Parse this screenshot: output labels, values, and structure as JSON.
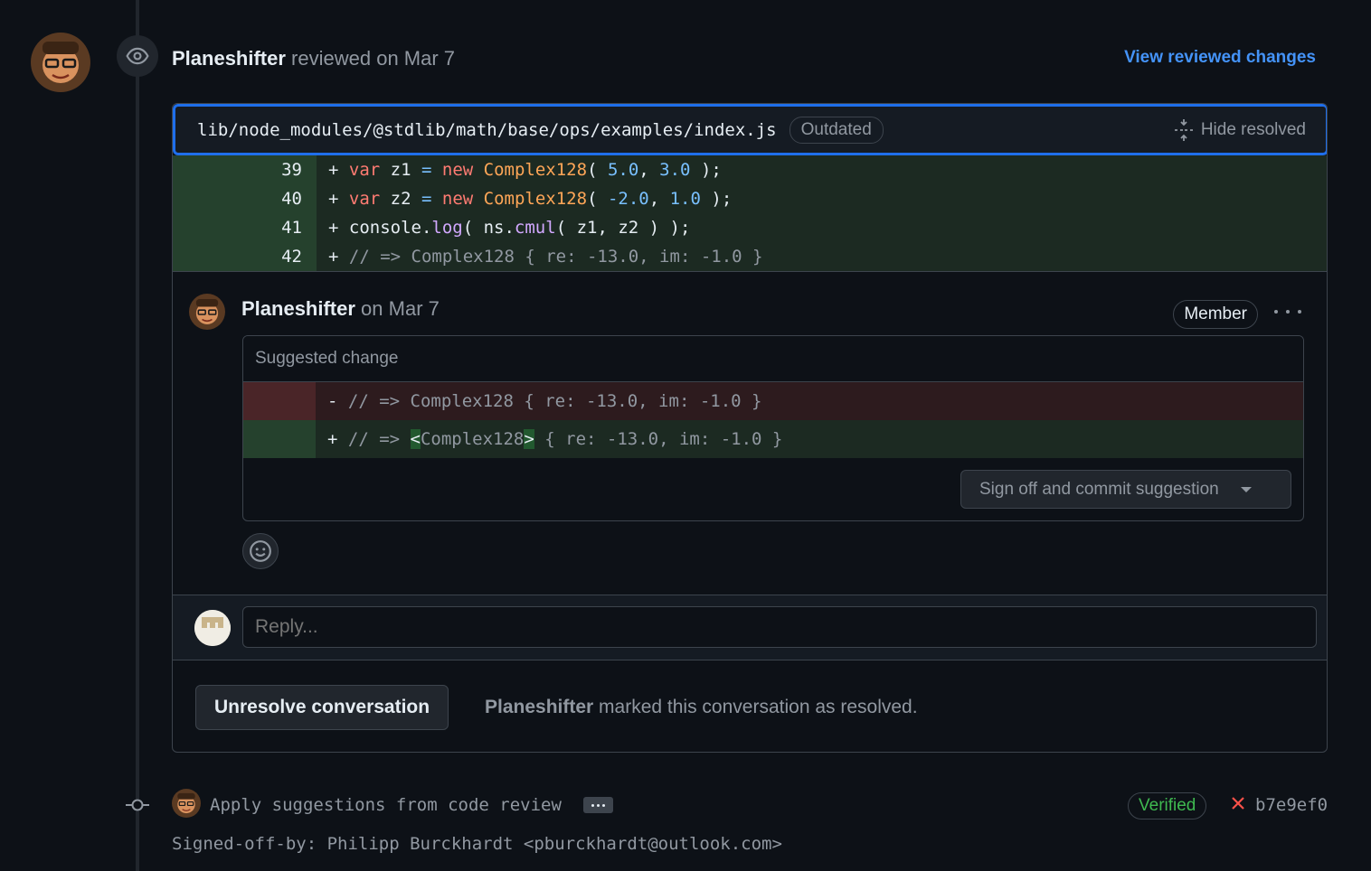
{
  "review": {
    "author": "Planeshifter",
    "action": " reviewed on Mar 7",
    "view_changes_label": "View reviewed changes"
  },
  "file": {
    "path": "lib/node_modules/@stdlib/math/base/ops/examples/index.js",
    "outdated_label": "Outdated",
    "hide_resolved_label": "Hide resolved"
  },
  "diff_lines": [
    {
      "num": "39",
      "code": "+ var z1 = new Complex128( 5.0, 3.0 );"
    },
    {
      "num": "40",
      "code": "+ var z2 = new Complex128( -2.0, 1.0 );"
    },
    {
      "num": "41",
      "code": "+ console.log( ns.cmul( z1, z2 ) );"
    },
    {
      "num": "42",
      "code": "+ // => Complex128 { re: -13.0, im: -1.0 }"
    }
  ],
  "comment": {
    "author": "Planeshifter",
    "date": " on Mar 7",
    "member_label": "Member",
    "suggested_change_label": "Suggested change",
    "removed_line": "- // => Complex128 { re: -13.0, im: -1.0 }",
    "added_line": "+ // => <Complex128> { re: -13.0, im: -1.0 }",
    "signoff_button_label": "Sign off and commit suggestion"
  },
  "reply": {
    "placeholder": "Reply..."
  },
  "resolved": {
    "button_label": "Unresolve conversation",
    "author": "Planeshifter",
    "message": " marked this conversation as resolved."
  },
  "commit": {
    "message": "Apply suggestions from code review",
    "verified_label": "Verified",
    "sha": "b7e9ef0",
    "signed_off": "Signed-off-by: Philipp Burckhardt <pburckhardt@outlook.com>"
  },
  "colors": {
    "background": "#0d1117",
    "accent": "#4493f8",
    "addition": "#1c2a22",
    "deletion": "#2d1b1e",
    "verified": "#3fb950",
    "failure": "#f85149"
  },
  "icons": {
    "review": "eye-icon",
    "hide_resolved": "fold-icon",
    "emoji": "smiley-icon",
    "commit": "git-commit-icon",
    "status": "x-icon",
    "menu": "kebab-horizontal-icon",
    "dropdown": "triangle-down-icon"
  }
}
